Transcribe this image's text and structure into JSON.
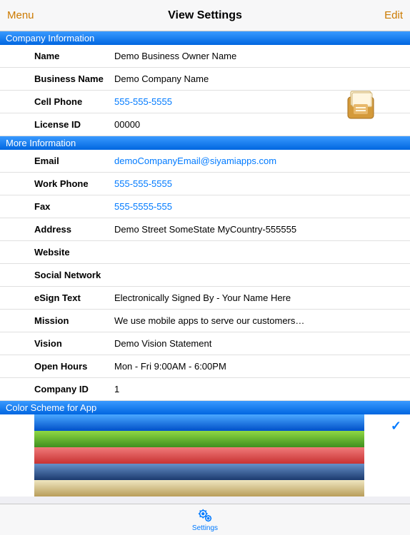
{
  "nav": {
    "menu": "Menu",
    "title": "View Settings",
    "edit": "Edit"
  },
  "sections": {
    "company_info": "Company Information",
    "more_info": "More Information",
    "color_scheme": "Color Scheme for App"
  },
  "company": {
    "name_label": "Name",
    "name_value": "Demo Business Owner Name",
    "business_label": "Business Name",
    "business_value": "Demo Company Name",
    "cell_label": "Cell Phone",
    "cell_value": "555-555-5555",
    "license_label": "License ID",
    "license_value": "00000"
  },
  "more": {
    "email_label": "Email",
    "email_value": "demoCompanyEmail@siyamiapps.com",
    "workphone_label": "Work Phone",
    "workphone_value": "555-555-5555",
    "fax_label": "Fax",
    "fax_value": "555-5555-555",
    "address_label": "Address",
    "address_value": "Demo Street SomeState MyCountry-555555",
    "website_label": "Website",
    "website_value": "",
    "social_label": "Social Network",
    "social_value": "",
    "esign_label": "eSign Text",
    "esign_value": "Electronically Signed By - Your Name Here",
    "mission_label": "Mission",
    "mission_value": "We use mobile apps to serve our customers…",
    "vision_label": "Vision",
    "vision_value": "Demo Vision Statement",
    "hours_label": "Open Hours",
    "hours_value": "Mon - Fri 9:00AM - 6:00PM",
    "companyid_label": "Company ID",
    "companyid_value": "1"
  },
  "tab": {
    "settings": "Settings"
  }
}
